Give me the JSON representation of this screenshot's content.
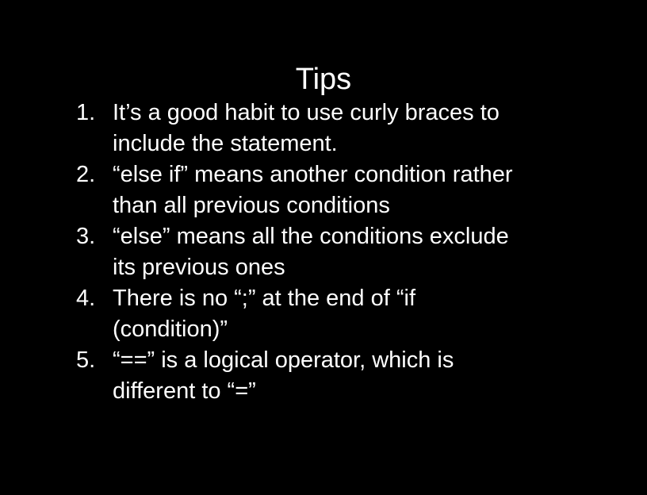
{
  "slide": {
    "title": "Tips",
    "items": [
      {
        "number": "1.",
        "lines": [
          "It’s a good habit to use curly braces to",
          "include the statement."
        ]
      },
      {
        "number": "2.",
        "lines": [
          "“else if” means another condition rather",
          "than all previous conditions"
        ]
      },
      {
        "number": "3.",
        "lines": [
          "“else” means all the conditions exclude",
          "its previous ones"
        ]
      },
      {
        "number": "4.",
        "lines": [
          "There is no “;” at the end of “if",
          "(condition)”"
        ]
      },
      {
        "number": "5.",
        "lines": [
          "“==” is a logical operator, which is",
          "different to “=”"
        ]
      }
    ],
    "colors": {
      "background": "#000000",
      "text": "#ffffff"
    }
  }
}
